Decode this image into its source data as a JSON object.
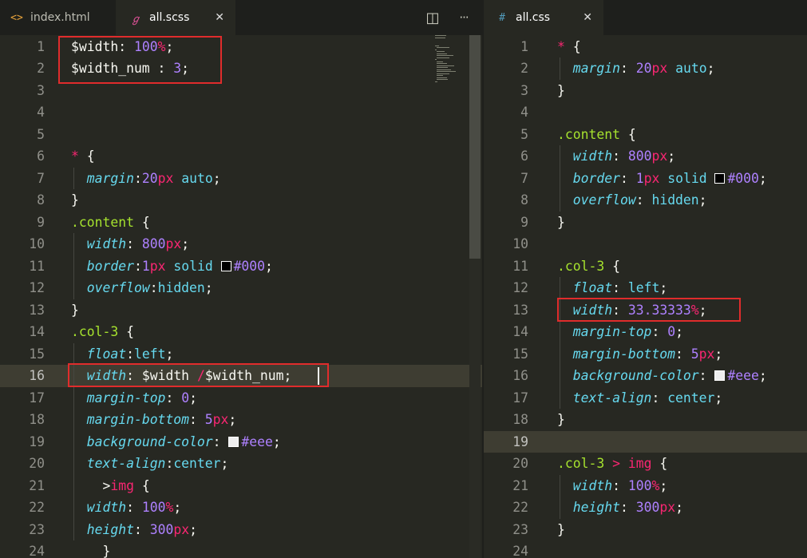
{
  "left_pane": {
    "tabs": [
      {
        "label": "index.html",
        "icon": "code-brackets-icon",
        "glyph": "<>",
        "color": "#e8a33b"
      },
      {
        "label": "all.scss",
        "icon": "sass-icon",
        "glyph": "ℊ",
        "color": "#e2529a",
        "close": "✕"
      }
    ],
    "actions": [
      {
        "icon": "split-editor-icon",
        "glyph": "◫"
      },
      {
        "icon": "more-icon",
        "glyph": "···"
      }
    ],
    "current_line": 16,
    "lines": [
      {
        "n": "1",
        "tokens": [
          [
            "$width",
            "var"
          ],
          [
            ": ",
            "pun"
          ],
          [
            "100",
            "num"
          ],
          [
            "%",
            "unit"
          ],
          [
            ";",
            "pun"
          ]
        ]
      },
      {
        "n": "2",
        "tokens": [
          [
            "$width_num",
            "var"
          ],
          [
            " : ",
            "pun"
          ],
          [
            "3",
            "num"
          ],
          [
            ";",
            "pun"
          ]
        ]
      },
      {
        "n": "3",
        "tokens": []
      },
      {
        "n": "4",
        "tokens": []
      },
      {
        "n": "5",
        "tokens": []
      },
      {
        "n": "6",
        "tokens": [
          [
            "*",
            "star"
          ],
          [
            " {",
            "pun"
          ]
        ]
      },
      {
        "n": "7",
        "tokens": [
          [
            "  ",
            "pun"
          ],
          [
            "margin",
            "prop"
          ],
          [
            ":",
            "pun"
          ],
          [
            "20",
            "num"
          ],
          [
            "px",
            "unit"
          ],
          [
            " ",
            "pun"
          ],
          [
            "auto",
            "kw"
          ],
          [
            ";",
            "pun"
          ]
        ]
      },
      {
        "n": "8",
        "tokens": [
          [
            "}",
            "pun"
          ]
        ]
      },
      {
        "n": "9",
        "tokens": [
          [
            ".content",
            "sel"
          ],
          [
            " {",
            "pun"
          ]
        ]
      },
      {
        "n": "10",
        "tokens": [
          [
            "  ",
            "pun"
          ],
          [
            "width",
            "prop"
          ],
          [
            ": ",
            "pun"
          ],
          [
            "800",
            "num"
          ],
          [
            "px",
            "unit"
          ],
          [
            ";",
            "pun"
          ]
        ]
      },
      {
        "n": "11",
        "tokens": [
          [
            "  ",
            "pun"
          ],
          [
            "border",
            "prop"
          ],
          [
            ":",
            "pun"
          ],
          [
            "1",
            "num"
          ],
          [
            "px",
            "unit"
          ],
          [
            " ",
            "pun"
          ],
          [
            "solid",
            "kw"
          ],
          [
            " ",
            "pun"
          ],
          [
            "#000000",
            "swatch"
          ],
          [
            "#000",
            "hex"
          ],
          [
            ";",
            "pun"
          ]
        ]
      },
      {
        "n": "12",
        "tokens": [
          [
            "  ",
            "pun"
          ],
          [
            "overflow",
            "prop"
          ],
          [
            ":",
            "pun"
          ],
          [
            "hidden",
            "kw"
          ],
          [
            ";",
            "pun"
          ]
        ]
      },
      {
        "n": "13",
        "tokens": [
          [
            "}",
            "pun"
          ]
        ]
      },
      {
        "n": "14",
        "tokens": [
          [
            ".col-3",
            "sel"
          ],
          [
            " {",
            "pun"
          ]
        ]
      },
      {
        "n": "15",
        "tokens": [
          [
            "  ",
            "pun"
          ],
          [
            "float",
            "prop"
          ],
          [
            ":",
            "pun"
          ],
          [
            "left",
            "kw"
          ],
          [
            ";",
            "pun"
          ]
        ]
      },
      {
        "n": "16",
        "tokens": [
          [
            "  ",
            "pun"
          ],
          [
            "width",
            "prop"
          ],
          [
            ": ",
            "pun"
          ],
          [
            "$width",
            "var"
          ],
          [
            " ",
            "pun"
          ],
          [
            "/",
            "op"
          ],
          [
            "$width_num",
            "var"
          ],
          [
            ";",
            "pun"
          ]
        ]
      },
      {
        "n": "17",
        "tokens": [
          [
            "  ",
            "pun"
          ],
          [
            "margin-top",
            "prop"
          ],
          [
            ": ",
            "pun"
          ],
          [
            "0",
            "num"
          ],
          [
            ";",
            "pun"
          ]
        ]
      },
      {
        "n": "18",
        "tokens": [
          [
            "  ",
            "pun"
          ],
          [
            "margin-bottom",
            "prop"
          ],
          [
            ": ",
            "pun"
          ],
          [
            "5",
            "num"
          ],
          [
            "px",
            "unit"
          ],
          [
            ";",
            "pun"
          ]
        ]
      },
      {
        "n": "19",
        "tokens": [
          [
            "  ",
            "pun"
          ],
          [
            "background-color",
            "prop"
          ],
          [
            ": ",
            "pun"
          ],
          [
            "#eeeeee",
            "swatch"
          ],
          [
            "#eee",
            "hex"
          ],
          [
            ";",
            "pun"
          ]
        ]
      },
      {
        "n": "20",
        "tokens": [
          [
            "  ",
            "pun"
          ],
          [
            "text-align",
            "prop"
          ],
          [
            ":",
            "pun"
          ],
          [
            "center",
            "kw"
          ],
          [
            ";",
            "pun"
          ]
        ]
      },
      {
        "n": "21",
        "tokens": [
          [
            "    ",
            "pun"
          ],
          [
            ">",
            "pun"
          ],
          [
            "img",
            "op"
          ],
          [
            " {",
            "pun"
          ]
        ]
      },
      {
        "n": "22",
        "tokens": [
          [
            "  ",
            "pun"
          ],
          [
            "width",
            "prop"
          ],
          [
            ": ",
            "pun"
          ],
          [
            "100",
            "num"
          ],
          [
            "%",
            "unit"
          ],
          [
            ";",
            "pun"
          ]
        ]
      },
      {
        "n": "23",
        "tokens": [
          [
            "  ",
            "pun"
          ],
          [
            "height",
            "prop"
          ],
          [
            ": ",
            "pun"
          ],
          [
            "300",
            "num"
          ],
          [
            "px",
            "unit"
          ],
          [
            ";",
            "pun"
          ]
        ]
      },
      {
        "n": "24",
        "tokens": [
          [
            "    ",
            "pun"
          ],
          [
            "}",
            "pun"
          ]
        ]
      }
    ]
  },
  "right_pane": {
    "tabs": [
      {
        "label": "all.css",
        "icon": "css-hash-icon",
        "glyph": "#",
        "color": "#519aba",
        "close": "✕"
      }
    ],
    "current_line": 19,
    "lines": [
      {
        "n": "1",
        "tokens": [
          [
            "*",
            "star"
          ],
          [
            " {",
            "pun"
          ]
        ]
      },
      {
        "n": "2",
        "tokens": [
          [
            "  ",
            "pun"
          ],
          [
            "margin",
            "prop"
          ],
          [
            ": ",
            "pun"
          ],
          [
            "20",
            "num"
          ],
          [
            "px",
            "unit"
          ],
          [
            " ",
            "pun"
          ],
          [
            "auto",
            "kw"
          ],
          [
            ";",
            "pun"
          ]
        ]
      },
      {
        "n": "3",
        "tokens": [
          [
            "}",
            "pun"
          ]
        ]
      },
      {
        "n": "4",
        "tokens": []
      },
      {
        "n": "5",
        "tokens": [
          [
            ".content",
            "sel"
          ],
          [
            " {",
            "pun"
          ]
        ]
      },
      {
        "n": "6",
        "tokens": [
          [
            "  ",
            "pun"
          ],
          [
            "width",
            "prop"
          ],
          [
            ": ",
            "pun"
          ],
          [
            "800",
            "num"
          ],
          [
            "px",
            "unit"
          ],
          [
            ";",
            "pun"
          ]
        ]
      },
      {
        "n": "7",
        "tokens": [
          [
            "  ",
            "pun"
          ],
          [
            "border",
            "prop"
          ],
          [
            ": ",
            "pun"
          ],
          [
            "1",
            "num"
          ],
          [
            "px",
            "unit"
          ],
          [
            " ",
            "pun"
          ],
          [
            "solid",
            "kw"
          ],
          [
            " ",
            "pun"
          ],
          [
            "#000000",
            "swatch"
          ],
          [
            "#000",
            "hex"
          ],
          [
            ";",
            "pun"
          ]
        ]
      },
      {
        "n": "8",
        "tokens": [
          [
            "  ",
            "pun"
          ],
          [
            "overflow",
            "prop"
          ],
          [
            ": ",
            "pun"
          ],
          [
            "hidden",
            "kw"
          ],
          [
            ";",
            "pun"
          ]
        ]
      },
      {
        "n": "9",
        "tokens": [
          [
            "}",
            "pun"
          ]
        ]
      },
      {
        "n": "10",
        "tokens": []
      },
      {
        "n": "11",
        "tokens": [
          [
            ".col-3",
            "sel"
          ],
          [
            " {",
            "pun"
          ]
        ]
      },
      {
        "n": "12",
        "tokens": [
          [
            "  ",
            "pun"
          ],
          [
            "float",
            "prop"
          ],
          [
            ": ",
            "pun"
          ],
          [
            "left",
            "kw"
          ],
          [
            ";",
            "pun"
          ]
        ]
      },
      {
        "n": "13",
        "tokens": [
          [
            "  ",
            "pun"
          ],
          [
            "width",
            "prop"
          ],
          [
            ": ",
            "pun"
          ],
          [
            "33.33333",
            "num"
          ],
          [
            "%",
            "unit"
          ],
          [
            ";",
            "pun"
          ]
        ]
      },
      {
        "n": "14",
        "tokens": [
          [
            "  ",
            "pun"
          ],
          [
            "margin-top",
            "prop"
          ],
          [
            ": ",
            "pun"
          ],
          [
            "0",
            "num"
          ],
          [
            ";",
            "pun"
          ]
        ]
      },
      {
        "n": "15",
        "tokens": [
          [
            "  ",
            "pun"
          ],
          [
            "margin-bottom",
            "prop"
          ],
          [
            ": ",
            "pun"
          ],
          [
            "5",
            "num"
          ],
          [
            "px",
            "unit"
          ],
          [
            ";",
            "pun"
          ]
        ]
      },
      {
        "n": "16",
        "tokens": [
          [
            "  ",
            "pun"
          ],
          [
            "background-color",
            "prop"
          ],
          [
            ": ",
            "pun"
          ],
          [
            "#eeeeee",
            "swatch"
          ],
          [
            "#eee",
            "hex"
          ],
          [
            ";",
            "pun"
          ]
        ]
      },
      {
        "n": "17",
        "tokens": [
          [
            "  ",
            "pun"
          ],
          [
            "text-align",
            "prop"
          ],
          [
            ": ",
            "pun"
          ],
          [
            "center",
            "kw"
          ],
          [
            ";",
            "pun"
          ]
        ]
      },
      {
        "n": "18",
        "tokens": [
          [
            "}",
            "pun"
          ]
        ]
      },
      {
        "n": "19",
        "tokens": []
      },
      {
        "n": "20",
        "tokens": [
          [
            ".col-3",
            "sel"
          ],
          [
            " ",
            "pun"
          ],
          [
            ">",
            "op"
          ],
          [
            " ",
            "pun"
          ],
          [
            "img",
            "op"
          ],
          [
            " {",
            "pun"
          ]
        ]
      },
      {
        "n": "21",
        "tokens": [
          [
            "  ",
            "pun"
          ],
          [
            "width",
            "prop"
          ],
          [
            ": ",
            "pun"
          ],
          [
            "100",
            "num"
          ],
          [
            "%",
            "unit"
          ],
          [
            ";",
            "pun"
          ]
        ]
      },
      {
        "n": "22",
        "tokens": [
          [
            "  ",
            "pun"
          ],
          [
            "height",
            "prop"
          ],
          [
            ": ",
            "pun"
          ],
          [
            "300",
            "num"
          ],
          [
            "px",
            "unit"
          ],
          [
            ";",
            "pun"
          ]
        ]
      },
      {
        "n": "23",
        "tokens": [
          [
            "}",
            "pun"
          ]
        ]
      },
      {
        "n": "24",
        "tokens": []
      }
    ]
  },
  "colors": {
    "editor_bg": "#272822",
    "tabbar_bg": "#1e1f1c",
    "highlight_box": "#e02c2c",
    "current_line_bg": "#3e3d32"
  }
}
